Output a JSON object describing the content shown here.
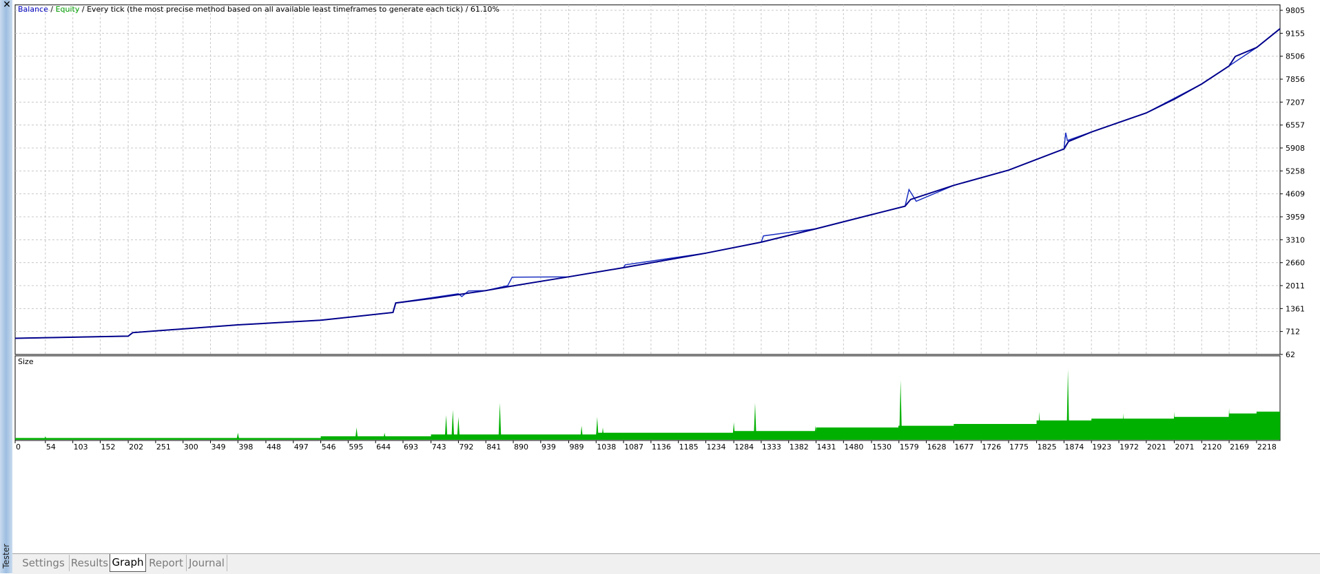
{
  "window": {
    "sidebar_label": "Tester",
    "close_icon": "close-icon"
  },
  "main_chart": {
    "legend": {
      "balance": "Balance",
      "sep1": " / ",
      "equity": "Equity",
      "rest": " / Every tick (the most precise method based on all available least timeframes to generate each tick) / 61.10%"
    },
    "colors": {
      "balance": "#00008b",
      "equity": "#00a000",
      "grid": "#c8c8c8"
    }
  },
  "sub_chart": {
    "label": "Size",
    "color": "#00b000"
  },
  "tabs": [
    "Settings",
    "Results",
    "Graph",
    "Report",
    "Journal"
  ],
  "active_tab": "Graph",
  "chart_data": [
    {
      "type": "line",
      "title": "",
      "series": [
        {
          "name": "Balance",
          "points": [
            [
              0,
              520
            ],
            [
              202,
              580
            ],
            [
              210,
              680
            ],
            [
              398,
              900
            ],
            [
              546,
              1030
            ],
            [
              675,
              1250
            ],
            [
              680,
              1520
            ],
            [
              750,
              1660
            ],
            [
              841,
              1870
            ],
            [
              880,
              1980
            ],
            [
              989,
              2260
            ],
            [
              1087,
              2520
            ],
            [
              1234,
              2930
            ],
            [
              1333,
              3240
            ],
            [
              1431,
              3620
            ],
            [
              1530,
              4020
            ],
            [
              1590,
              4260
            ],
            [
              1600,
              4450
            ],
            [
              1677,
              4850
            ],
            [
              1775,
              5280
            ],
            [
              1874,
              5880
            ],
            [
              1882,
              6090
            ],
            [
              1923,
              6360
            ],
            [
              2021,
              6900
            ],
            [
              2071,
              7290
            ],
            [
              2120,
              7720
            ],
            [
              2169,
              8230
            ],
            [
              2180,
              8500
            ],
            [
              2218,
              8750
            ],
            [
              2260,
              9285
            ]
          ]
        },
        {
          "name": "Equity",
          "points": [
            [
              0,
              520
            ],
            [
              202,
              580
            ],
            [
              210,
              680
            ],
            [
              398,
              900
            ],
            [
              546,
              1030
            ],
            [
              675,
              1250
            ],
            [
              680,
              1520
            ],
            [
              792,
              1780
            ],
            [
              798,
              1700
            ],
            [
              810,
              1860
            ],
            [
              841,
              1870
            ],
            [
              880,
              2010
            ],
            [
              888,
              2250
            ],
            [
              989,
              2260
            ],
            [
              1087,
              2520
            ],
            [
              1090,
              2600
            ],
            [
              1234,
              2930
            ],
            [
              1333,
              3240
            ],
            [
              1337,
              3420
            ],
            [
              1431,
              3620
            ],
            [
              1530,
              4020
            ],
            [
              1590,
              4260
            ],
            [
              1597,
              4730
            ],
            [
              1610,
              4400
            ],
            [
              1677,
              4850
            ],
            [
              1775,
              5280
            ],
            [
              1874,
              5880
            ],
            [
              1877,
              6340
            ],
            [
              1880,
              6120
            ],
            [
              1923,
              6360
            ],
            [
              2021,
              6900
            ],
            [
              2120,
              7720
            ],
            [
              2169,
              8230
            ],
            [
              2218,
              8750
            ],
            [
              2260,
              9285
            ]
          ]
        }
      ],
      "y_ticks": [
        62,
        712,
        1361,
        2011,
        2660,
        3310,
        3959,
        4609,
        5258,
        5908,
        6557,
        7207,
        7856,
        8506,
        9155,
        9805
      ],
      "ylim": [
        62,
        9805
      ],
      "xlim": [
        0,
        2260
      ]
    },
    {
      "type": "area",
      "title": "Size",
      "series": [
        {
          "name": "Size",
          "points": [
            [
              0,
              1
            ],
            [
              546,
              1
            ],
            [
              546,
              2
            ],
            [
              743,
              2
            ],
            [
              743,
              3
            ],
            [
              1038,
              3
            ],
            [
              1038,
              4
            ],
            [
              1284,
              4
            ],
            [
              1284,
              5
            ],
            [
              1431,
              5
            ],
            [
              1431,
              7
            ],
            [
              1578,
              7
            ],
            [
              1578,
              8
            ],
            [
              1677,
              8
            ],
            [
              1677,
              9
            ],
            [
              1825,
              9
            ],
            [
              1825,
              11
            ],
            [
              1923,
              11
            ],
            [
              1923,
              12
            ],
            [
              2071,
              12
            ],
            [
              2071,
              13
            ],
            [
              2169,
              13
            ],
            [
              2169,
              15
            ],
            [
              2218,
              15
            ],
            [
              2218,
              16
            ],
            [
              2260,
              16
            ]
          ],
          "spikes": [
            [
              54,
              2
            ],
            [
              398,
              4
            ],
            [
              610,
              7
            ],
            [
              660,
              4
            ],
            [
              770,
              14
            ],
            [
              782,
              17
            ],
            [
              792,
              13
            ],
            [
              866,
              21
            ],
            [
              1012,
              8
            ],
            [
              1040,
              13
            ],
            [
              1050,
              7
            ],
            [
              1284,
              10
            ],
            [
              1322,
              21
            ],
            [
              1430,
              8
            ],
            [
              1582,
              34
            ],
            [
              1830,
              16
            ],
            [
              1881,
              40
            ],
            [
              1980,
              15
            ],
            [
              2020,
              12
            ],
            [
              2028,
              10
            ],
            [
              2071,
              16
            ],
            [
              2090,
              13
            ],
            [
              2169,
              18
            ],
            [
              2226,
              16
            ],
            [
              2240,
              14
            ]
          ]
        }
      ],
      "x_ticks": [
        0,
        54,
        103,
        152,
        202,
        251,
        300,
        349,
        398,
        448,
        497,
        546,
        595,
        644,
        693,
        743,
        792,
        841,
        890,
        939,
        989,
        1038,
        1087,
        1136,
        1185,
        1234,
        1284,
        1333,
        1382,
        1431,
        1480,
        1530,
        1579,
        1628,
        1677,
        1726,
        1775,
        1825,
        1874,
        1923,
        1972,
        2021,
        2071,
        2120,
        2169,
        2218
      ],
      "xlim": [
        0,
        2260
      ],
      "ylim": [
        0,
        45
      ]
    }
  ]
}
